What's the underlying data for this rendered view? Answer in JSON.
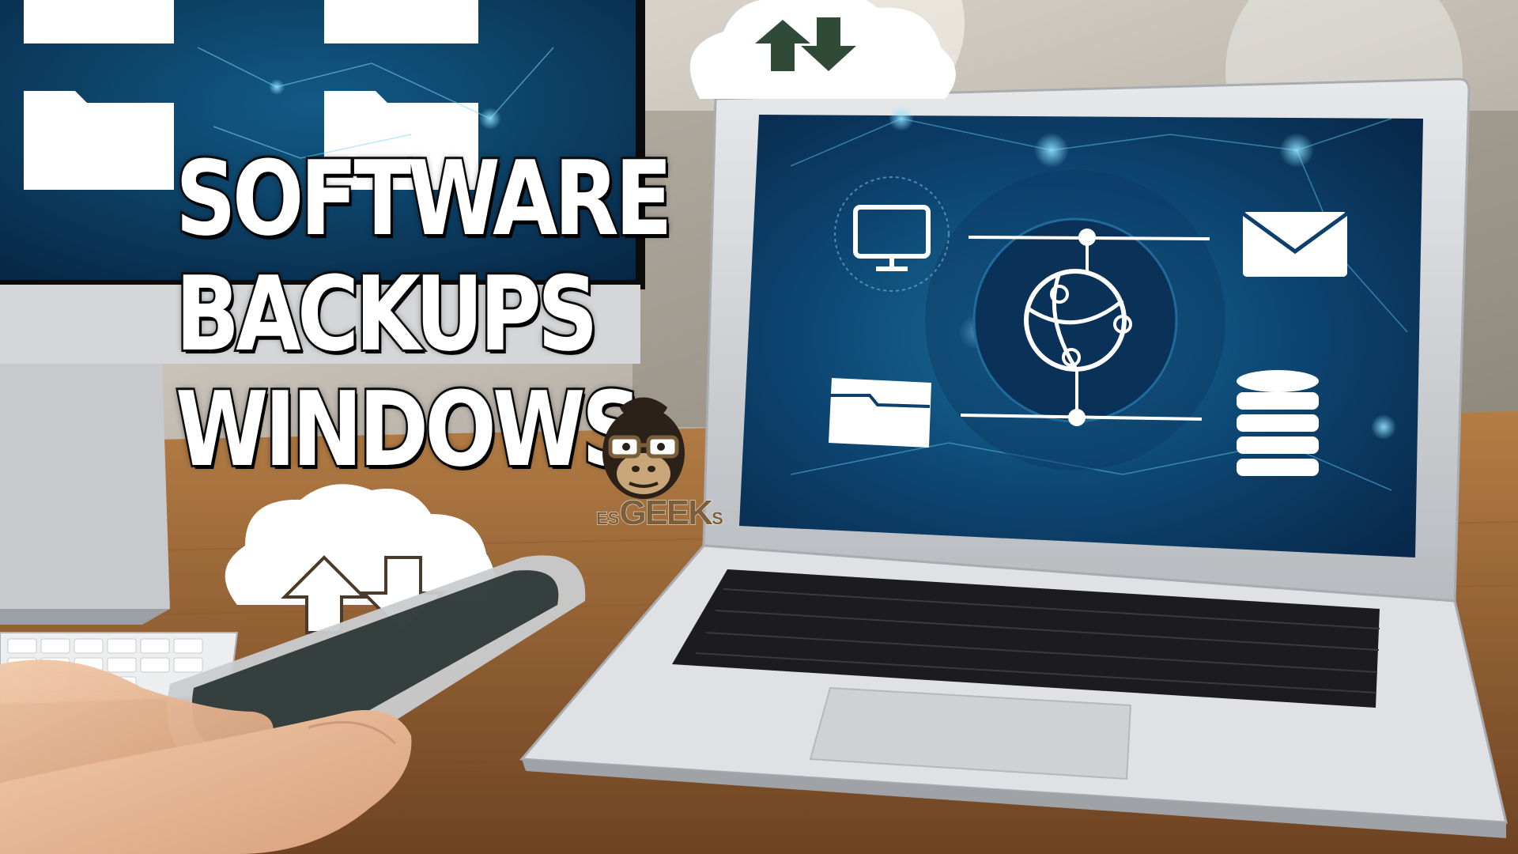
{
  "headline": {
    "line1": "SOFTWARE",
    "line2": "BACKUPS",
    "line3": "WINDOWS"
  },
  "logo": {
    "prefix": "ES",
    "word": "GEEK",
    "suffix": "S"
  },
  "icons": [
    "cloud-upload-download-icon",
    "monitor-icon",
    "envelope-icon",
    "globe-network-icon",
    "folder-icon",
    "database-icon",
    "gorilla-mascot-icon"
  ],
  "colors": {
    "screen_blue": "#0c3f6b",
    "wood": "#a8743f",
    "laptop_silver": "#d7d9dc"
  }
}
